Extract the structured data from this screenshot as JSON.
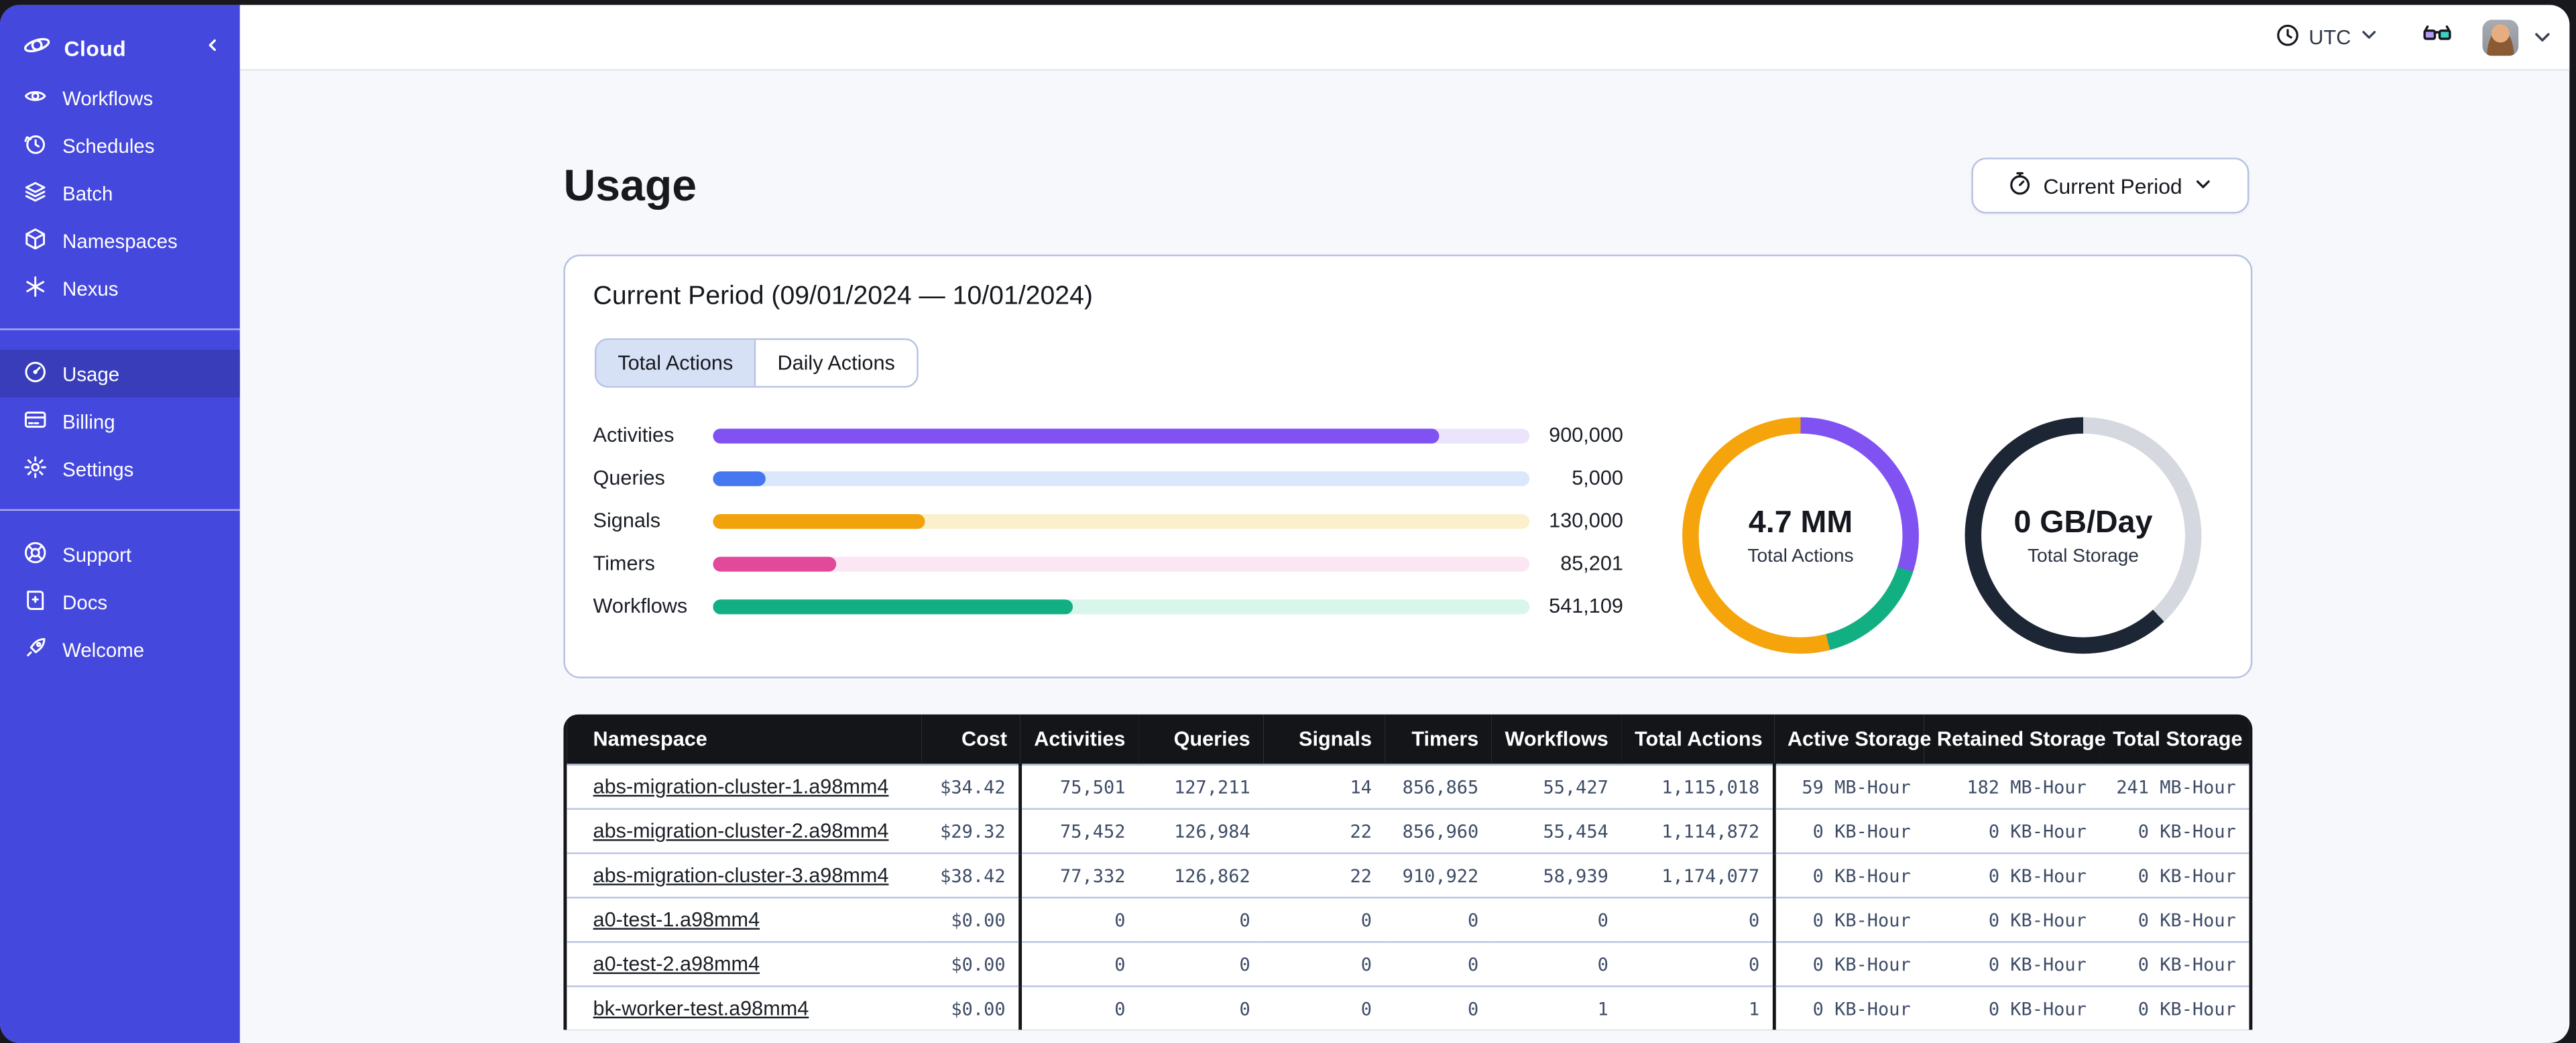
{
  "topbar": {
    "timezone_label": "UTC"
  },
  "sidebar": {
    "brand_label": "Cloud",
    "groups": [
      {
        "name": "main",
        "items": [
          {
            "icon": "workflows",
            "label": "Workflows"
          },
          {
            "icon": "schedules",
            "label": "Schedules"
          },
          {
            "icon": "batch",
            "label": "Batch"
          },
          {
            "icon": "namespaces",
            "label": "Namespaces"
          },
          {
            "icon": "nexus",
            "label": "Nexus"
          }
        ]
      },
      {
        "name": "account",
        "items": [
          {
            "icon": "usage",
            "label": "Usage",
            "active": true
          },
          {
            "icon": "billing",
            "label": "Billing"
          },
          {
            "icon": "settings",
            "label": "Settings"
          }
        ]
      },
      {
        "name": "footer",
        "items": [
          {
            "icon": "support",
            "label": "Support"
          },
          {
            "icon": "docs",
            "label": "Docs"
          },
          {
            "icon": "welcome",
            "label": "Welcome"
          }
        ]
      }
    ]
  },
  "page": {
    "title": "Usage",
    "period_button_label": "Current Period"
  },
  "usage_card": {
    "title": "Current Period (09/01/2024 — 10/01/2024)",
    "tabs": [
      {
        "label": "Total Actions",
        "active": true
      },
      {
        "label": "Daily Actions",
        "active": false
      }
    ],
    "chart_data": {
      "type": "bar",
      "orientation": "horizontal",
      "categories": [
        "Activities",
        "Queries",
        "Signals",
        "Timers",
        "Workflows"
      ],
      "values": [
        900000,
        5000,
        130000,
        85201,
        541109
      ],
      "value_labels": [
        "900,000",
        "5,000",
        "130,000",
        "85,201",
        "541,109"
      ],
      "fill_pct": [
        89,
        6.5,
        26,
        15,
        44
      ],
      "colors": [
        "#8152f2",
        "#4577f0",
        "#f2a30c",
        "#e2499a",
        "#12af82"
      ],
      "track_colors": [
        "#ebe4fb",
        "#dbe7fb",
        "#faf0cc",
        "#fbe6f4",
        "#d8f6e9"
      ]
    },
    "donuts": [
      {
        "type": "pie",
        "center_value": "4.7 MM",
        "center_label": "Total Actions",
        "segments": [
          {
            "color": "#8152f2",
            "pct": 30
          },
          {
            "color": "#12af82",
            "pct": 16
          },
          {
            "color": "#f5a40c",
            "pct": 54
          }
        ]
      },
      {
        "type": "pie",
        "center_value": "0 GB/Day",
        "center_label": "Total Storage",
        "segments": [
          {
            "color": "#d5d8de",
            "pct": 38
          },
          {
            "color": "#1c2634",
            "pct": 62
          }
        ]
      }
    ]
  },
  "table": {
    "columns": [
      "Namespace",
      "Cost",
      "Activities",
      "Queries",
      "Signals",
      "Timers",
      "Workflows",
      "Total Actions",
      "Active Storage",
      "Retained Storage",
      "Total Storage"
    ],
    "rows": [
      {
        "namespace": "abs-migration-cluster-1.a98mm4",
        "cells": [
          "$34.42",
          "75,501",
          "127,211",
          "14",
          "856,865",
          "55,427",
          "1,115,018",
          "59 MB-Hour",
          "182 MB-Hour",
          "241 MB-Hour"
        ]
      },
      {
        "namespace": "abs-migration-cluster-2.a98mm4",
        "cells": [
          "$29.32",
          "75,452",
          "126,984",
          "22",
          "856,960",
          "55,454",
          "1,114,872",
          "0 KB-Hour",
          "0 KB-Hour",
          "0 KB-Hour"
        ]
      },
      {
        "namespace": "abs-migration-cluster-3.a98mm4",
        "cells": [
          "$38.42",
          "77,332",
          "126,862",
          "22",
          "910,922",
          "58,939",
          "1,174,077",
          "0 KB-Hour",
          "0 KB-Hour",
          "0 KB-Hour"
        ]
      },
      {
        "namespace": "a0-test-1.a98mm4",
        "cells": [
          "$0.00",
          "0",
          "0",
          "0",
          "0",
          "0",
          "0",
          "0 KB-Hour",
          "0 KB-Hour",
          "0 KB-Hour"
        ]
      },
      {
        "namespace": "a0-test-2.a98mm4",
        "cells": [
          "$0.00",
          "0",
          "0",
          "0",
          "0",
          "0",
          "0",
          "0 KB-Hour",
          "0 KB-Hour",
          "0 KB-Hour"
        ]
      },
      {
        "namespace": "bk-worker-test.a98mm4",
        "cells": [
          "$0.00",
          "0",
          "0",
          "0",
          "0",
          "1",
          "1",
          "0 KB-Hour",
          "0 KB-Hour",
          "0 KB-Hour"
        ]
      }
    ]
  }
}
